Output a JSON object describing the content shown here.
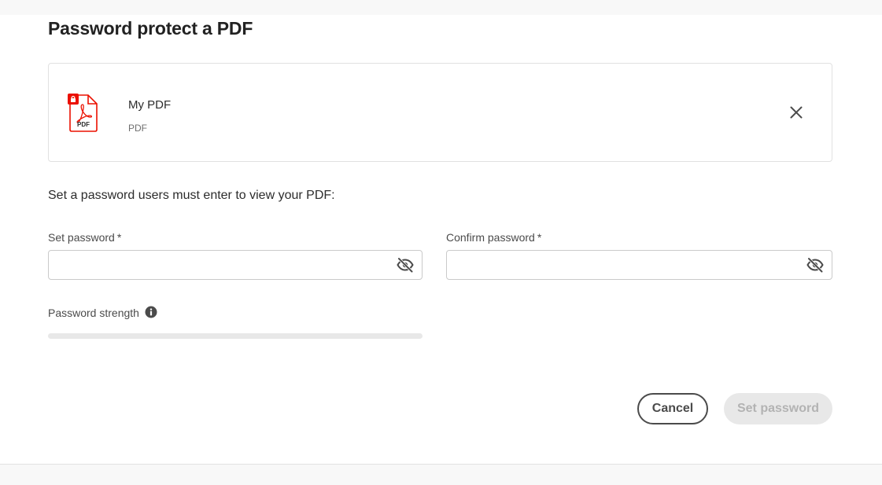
{
  "dialog": {
    "title": "Password protect a PDF"
  },
  "file": {
    "name": "My PDF",
    "type": "PDF",
    "icon": "pdf-lock-icon",
    "icon_label": "PDF",
    "remove_icon": "close-icon"
  },
  "instruction": "Set a password users must enter to view your PDF:",
  "fields": {
    "set_password": {
      "label": "Set password",
      "required_mark": "*",
      "value": "",
      "placeholder": "",
      "toggle_icon": "eye-off-icon"
    },
    "confirm_password": {
      "label": "Confirm password",
      "required_mark": "*",
      "value": "",
      "placeholder": "",
      "toggle_icon": "eye-off-icon"
    }
  },
  "strength": {
    "label": "Password strength",
    "info_icon": "info-icon",
    "level": 0
  },
  "buttons": {
    "cancel": "Cancel",
    "set_password": "Set password"
  },
  "colors": {
    "pdf_red": "#eb1000",
    "primary_text": "#2c2c2c",
    "muted_text": "#6e6e6e",
    "disabled_bg": "#e8e8e8",
    "disabled_text": "#b3b3b3"
  }
}
